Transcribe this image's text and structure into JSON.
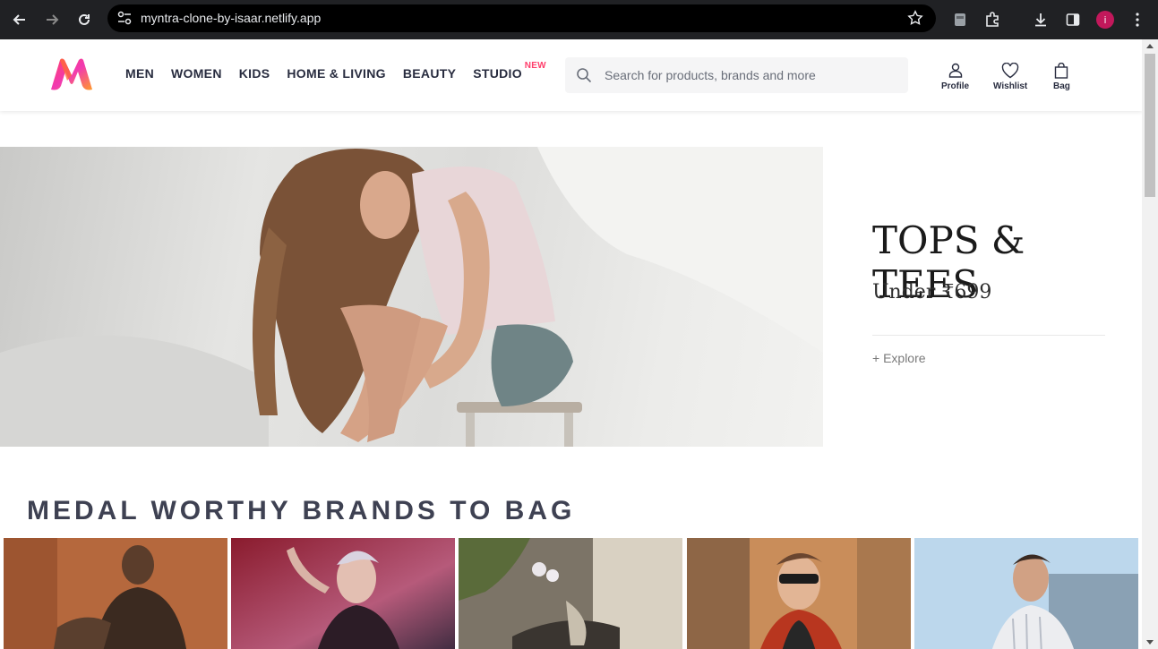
{
  "browser": {
    "url": "myntra-clone-by-isaar.netlify.app",
    "profile_initial": "i"
  },
  "header": {
    "nav": [
      {
        "label": "MEN"
      },
      {
        "label": "WOMEN"
      },
      {
        "label": "KIDS"
      },
      {
        "label": "HOME & LIVING"
      },
      {
        "label": "BEAUTY"
      },
      {
        "label": "STUDIO",
        "badge": "NEW"
      }
    ],
    "search_placeholder": "Search for products, brands and more",
    "actions": {
      "profile": "Profile",
      "wishlist": "Wishlist",
      "bag": "Bag"
    }
  },
  "hero": {
    "title": "TOPS & TEES",
    "subtitle": "Under ₹699",
    "cta": "+ Explore"
  },
  "section": {
    "title": "MEDAL WORTHY BRANDS TO BAG"
  },
  "colors": {
    "brand_pink": "#ff3f6c",
    "text_dark": "#282c3f",
    "section_text": "#3e4152"
  }
}
